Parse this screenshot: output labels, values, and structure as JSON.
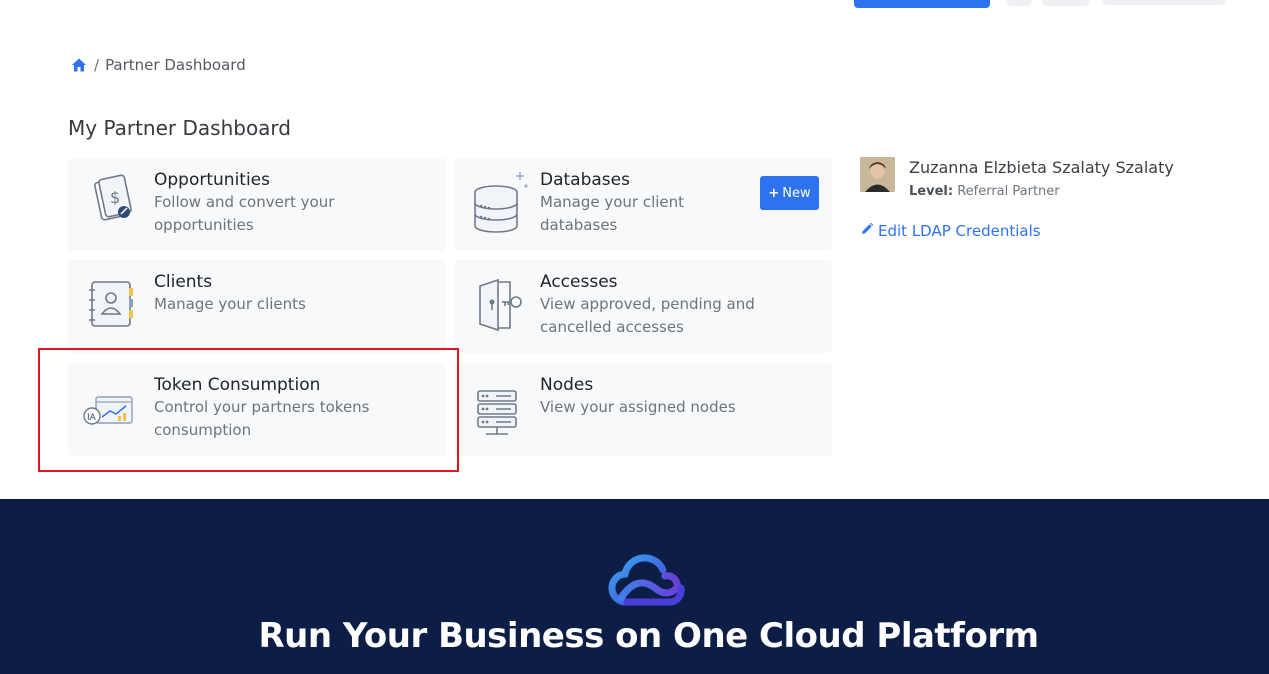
{
  "breadcrumb": {
    "current": "Partner Dashboard",
    "separator": "/"
  },
  "page_title": "My Partner Dashboard",
  "cards": [
    {
      "title": "Opportunities",
      "desc": "Follow and convert your opportunities",
      "icon": "document-dollar-icon"
    },
    {
      "title": "Databases",
      "desc": "Manage your client databases",
      "icon": "database-icon",
      "button": "New"
    },
    {
      "title": "Clients",
      "desc": "Manage your clients",
      "icon": "contact-book-icon"
    },
    {
      "title": "Accesses",
      "desc": "View approved, pending and cancelled accesses",
      "icon": "door-key-icon"
    },
    {
      "title": "Token Consumption",
      "desc": "Control your partners tokens consumption",
      "icon": "ia-analytics-icon"
    },
    {
      "title": "Nodes",
      "desc": "View your assigned nodes",
      "icon": "server-rack-icon"
    }
  ],
  "profile": {
    "name": "Zuzanna Elzbieta Szalaty Szalaty",
    "level_label": "Level:",
    "level_value": "Referral Partner",
    "edit_ldap": "Edit LDAP Credentials"
  },
  "footer": {
    "title": "Run Your Business on One Cloud Platform"
  },
  "colors": {
    "accent": "#2f72f0",
    "footer_bg": "#0c1e45",
    "highlight": "#e3141b"
  }
}
